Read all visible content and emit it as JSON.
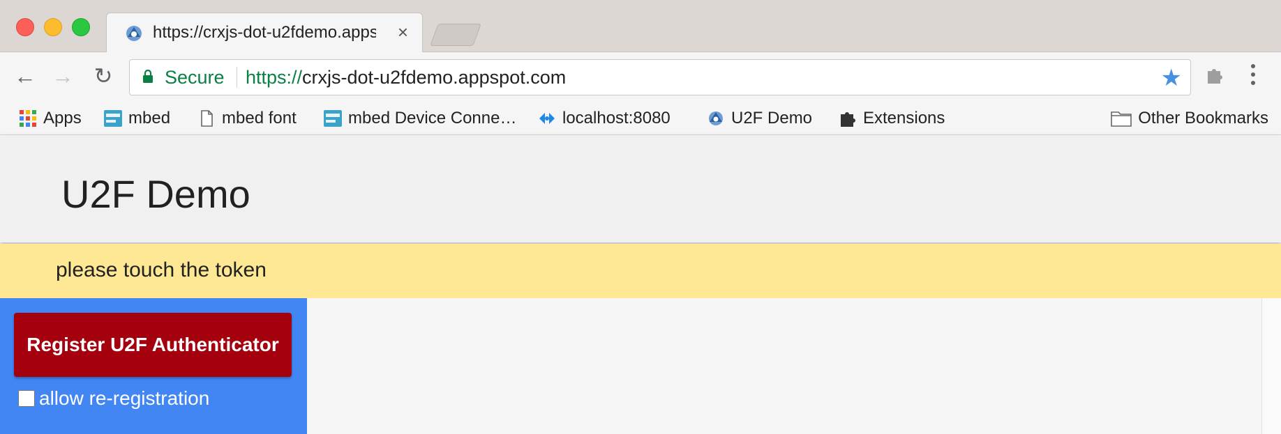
{
  "window": {
    "tab_title": "https://crxjs-dot-u2fdemo.appspot.com",
    "tab_close": "×"
  },
  "toolbar": {
    "back_icon": "←",
    "forward_icon": "→",
    "reload_icon": "↻",
    "secure_label": "Secure",
    "url_scheme": "https://",
    "url_host": "crxjs-dot-u2fdemo.appspot.com",
    "star_icon": "★"
  },
  "bookmarks": [
    {
      "label": "Apps",
      "icon": "apps-grid-icon"
    },
    {
      "label": "mbed",
      "icon": "arm-mbed-icon"
    },
    {
      "label": "mbed font",
      "icon": "document-icon"
    },
    {
      "label": "mbed Device Conne…",
      "icon": "arm-mbed-icon"
    },
    {
      "label": "localhost:8080",
      "icon": "blue-diamond-icon"
    },
    {
      "label": "U2F Demo",
      "icon": "u2f-favicon-icon"
    },
    {
      "label": "Extensions",
      "icon": "puzzle-icon"
    }
  ],
  "other_bookmarks": "Other Bookmarks",
  "page": {
    "title": "U2F Demo",
    "notice": "please touch the token",
    "register_button": "Register U2F Authenticator",
    "allow_reregistration": "allow re-registration"
  },
  "colors": {
    "notice_bg": "#fee894",
    "sidebar_bg": "#4286f4",
    "button_bg": "#a5000e",
    "secure_green": "#0b8043",
    "star_blue": "#4a90e2"
  }
}
